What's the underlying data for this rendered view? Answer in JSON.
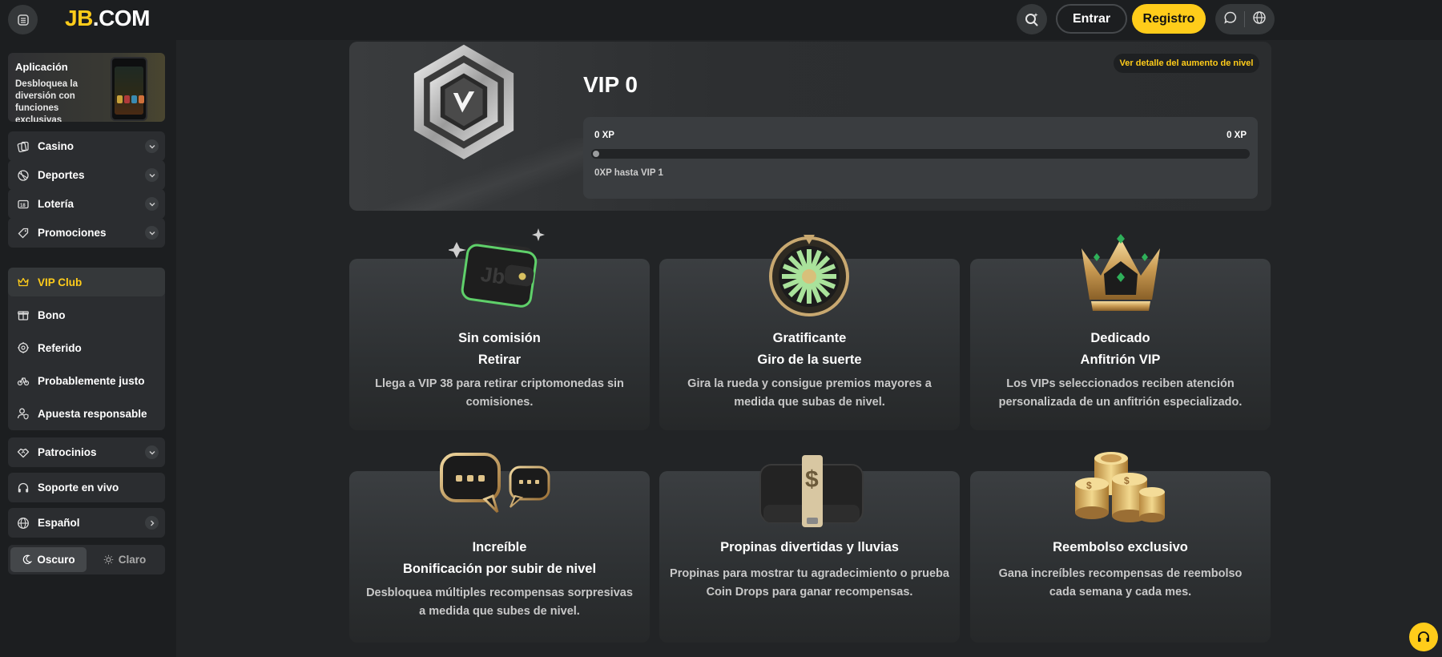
{
  "header": {
    "logo_jb": "JB",
    "logo_com": ".COM",
    "entrar_label": "Entrar",
    "registro_label": "Registro"
  },
  "sidebar": {
    "app_promo": {
      "title": "Aplicación",
      "description": "Desbloquea la diversión con funciones exclusivas"
    },
    "sections": [
      {
        "label": "Casino",
        "icon": "casino-icon"
      },
      {
        "label": "Deportes",
        "icon": "sports-ball-icon"
      },
      {
        "label": "Lotería",
        "icon": "lottery-icon"
      },
      {
        "label": "Promociones",
        "icon": "tag-icon"
      }
    ],
    "group": [
      {
        "label": "VIP Club",
        "icon": "crown-icon",
        "active": true
      },
      {
        "label": "Bono",
        "icon": "gift-icon"
      },
      {
        "label": "Referido",
        "icon": "referral-icon"
      },
      {
        "label": "Probablemente justo",
        "icon": "fair-icon"
      },
      {
        "label": "Apuesta responsable",
        "icon": "user-shield-icon"
      }
    ],
    "patrocinios": "Patrocinios",
    "soporte": "Soporte en vivo",
    "idioma": "Español",
    "theme": {
      "dark": "Oscuro",
      "light": "Claro",
      "selected": "Oscuro"
    }
  },
  "vip": {
    "title": "VIP 0",
    "detail_link": "Ver detalle del aumento de nivel",
    "xp_current": "0 XP",
    "xp_target": "0 XP",
    "progress": 0,
    "hint": "0XP hasta VIP 1"
  },
  "features": [
    {
      "title1": "Sin comisión",
      "title2": "Retirar",
      "desc": "Llega a VIP 38 para retirar criptomonedas sin comisiones.",
      "icon": "wallet-icon"
    },
    {
      "title1": "Gratificante",
      "title2": "Giro de la suerte",
      "desc": "Gira la rueda y consigue premios mayores a medida que subas de nivel.",
      "icon": "wheel-icon"
    },
    {
      "title1": "Dedicado",
      "title2": "Anfitrión VIP",
      "desc": "Los VIPs seleccionados reciben atención personalizada de un anfitrión especializado.",
      "icon": "crown-icon"
    },
    {
      "title1": "Increíble",
      "title2": "Bonificación por subir de nivel",
      "desc": "Desbloquea múltiples recompensas sorpresivas a medida que subes de nivel.",
      "icon": "chat-bubbles-icon"
    },
    {
      "title1": "Propinas divertidas y lluvias",
      "title2": "",
      "desc": "Propinas para mostrar tu agradecimiento o prueba Coin Drops para ganar recompensas.",
      "icon": "briefcase-icon"
    },
    {
      "title1": "Reembolso exclusivo",
      "title2": "",
      "desc": "Gana increíbles recompensas de reembolso cada semana y cada mes.",
      "icon": "coins-icon"
    }
  ],
  "colors": {
    "accent": "#ffcc1a",
    "background": "#222426",
    "panel": "#2b2d30"
  }
}
